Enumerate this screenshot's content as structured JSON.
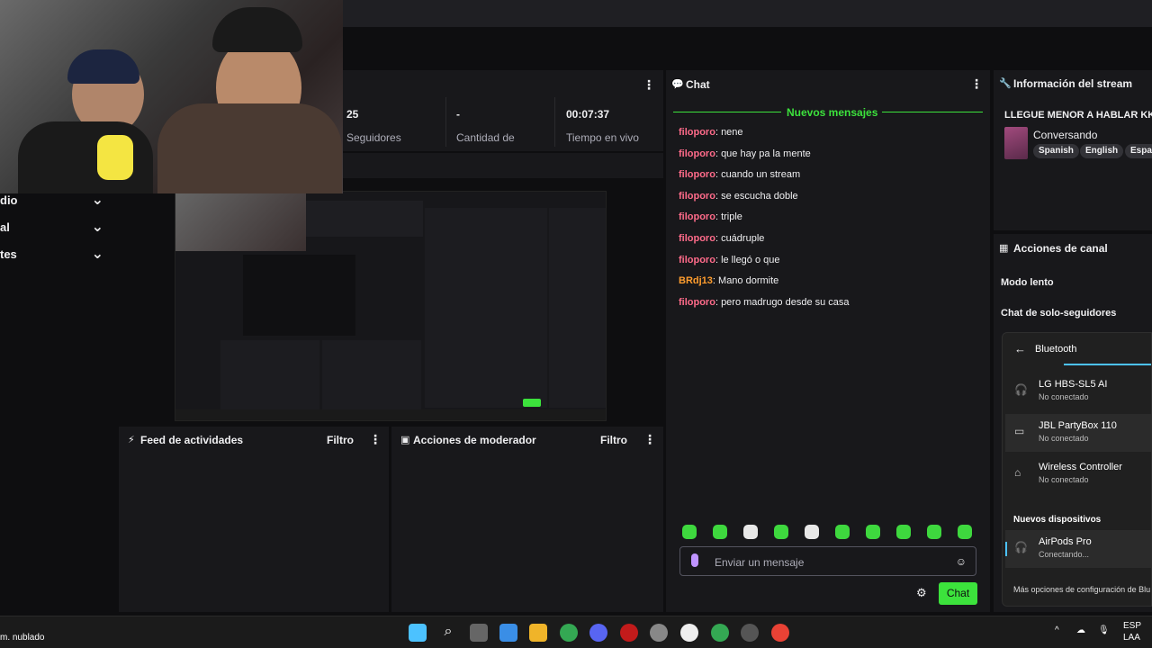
{
  "stats": {
    "followers_num": "25",
    "followers_label": "Seguidores",
    "count_num": "-",
    "count_label": "Cantidad de",
    "live_time": "00:07:37",
    "live_label": "Tiempo en vivo"
  },
  "leftnav": {
    "items": [
      "dio",
      "al",
      "tes"
    ]
  },
  "panels": {
    "activity_title": "Feed de actividades",
    "activity_filter": "Filtro",
    "mod_title": "Acciones de moderador",
    "mod_filter": "Filtro"
  },
  "chat": {
    "title": "Chat",
    "new_messages": "Nuevos mensajes",
    "messages": [
      {
        "user": "filoporo",
        "text": "nene",
        "color": "#ff6b8a"
      },
      {
        "user": "filoporo",
        "text": "que hay pa la mente",
        "color": "#ff6b8a"
      },
      {
        "user": "filoporo",
        "text": "cuando un stream",
        "color": "#ff6b8a"
      },
      {
        "user": "filoporo",
        "text": "se escucha doble",
        "color": "#ff6b8a"
      },
      {
        "user": "filoporo",
        "text": "triple",
        "color": "#ff6b8a"
      },
      {
        "user": "filoporo",
        "text": "cuádruple",
        "color": "#ff6b8a"
      },
      {
        "user": "filoporo",
        "text": "le llegó o que",
        "color": "#ff6b8a"
      },
      {
        "user": "BRdj13",
        "text": "Mano dormite",
        "color": "#ff9d2e"
      },
      {
        "user": "filoporo",
        "text": "pero madrugo desde su casa",
        "color": "#ff6b8a"
      }
    ],
    "input_placeholder": "Enviar un mensaje",
    "send_label": "Chat",
    "accent": "#3ce23c"
  },
  "stream_info": {
    "header": "Información del stream",
    "title": "LLEGUE MENOR A HABLAR KK",
    "category": "Conversando",
    "tags": [
      "Spanish",
      "English",
      "Espa"
    ]
  },
  "channel_actions": {
    "header": "Acciones de canal",
    "slow_mode": "Modo lento",
    "followers_only": "Chat de solo-seguidores"
  },
  "bluetooth": {
    "title": "Bluetooth",
    "devices": [
      {
        "name": "LG HBS-SL5 AI",
        "status": "No conectado",
        "icon": "headphones-icon"
      },
      {
        "name": "JBL PartyBox 110",
        "status": "No conectado",
        "icon": "speaker-icon"
      },
      {
        "name": "Wireless Controller",
        "status": "No conectado",
        "icon": "gamepad-icon"
      }
    ],
    "new_devices_label": "Nuevos dispositivos",
    "new_device": {
      "name": "AirPods Pro",
      "status": "Conectando...",
      "icon": "headphones-icon"
    },
    "more_options": "Más opciones de configuración de Blu"
  },
  "taskbar": {
    "weather": "m. nublado",
    "lang_top": "ESP",
    "lang_bottom": "LAA"
  }
}
